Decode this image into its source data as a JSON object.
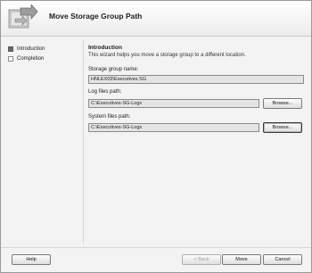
{
  "window": {
    "title": "Move Storage Group Path"
  },
  "steps": [
    {
      "label": "Introduction",
      "current": true
    },
    {
      "label": "Completion",
      "current": false
    }
  ],
  "content": {
    "section_title": "Introduction",
    "description": "This wizard helps you move a storage group to a different location.",
    "storage_group": {
      "label": "Storage group name:",
      "value": "HNLEX03\\Executives SG"
    },
    "log_path": {
      "label": "Log files path:",
      "value": "C:\\Executives-SG-Logs",
      "browse_label": "Browse..."
    },
    "system_path": {
      "label": "System files path:",
      "value": "C:\\Executives-SG-Logs",
      "browse_label": "Browse..."
    }
  },
  "footer": {
    "help_label": "Help",
    "back_label": "< Back",
    "move_label": "Move",
    "cancel_label": "Cancel"
  },
  "icons": {
    "wizard": "wizard-arrow-icon"
  }
}
